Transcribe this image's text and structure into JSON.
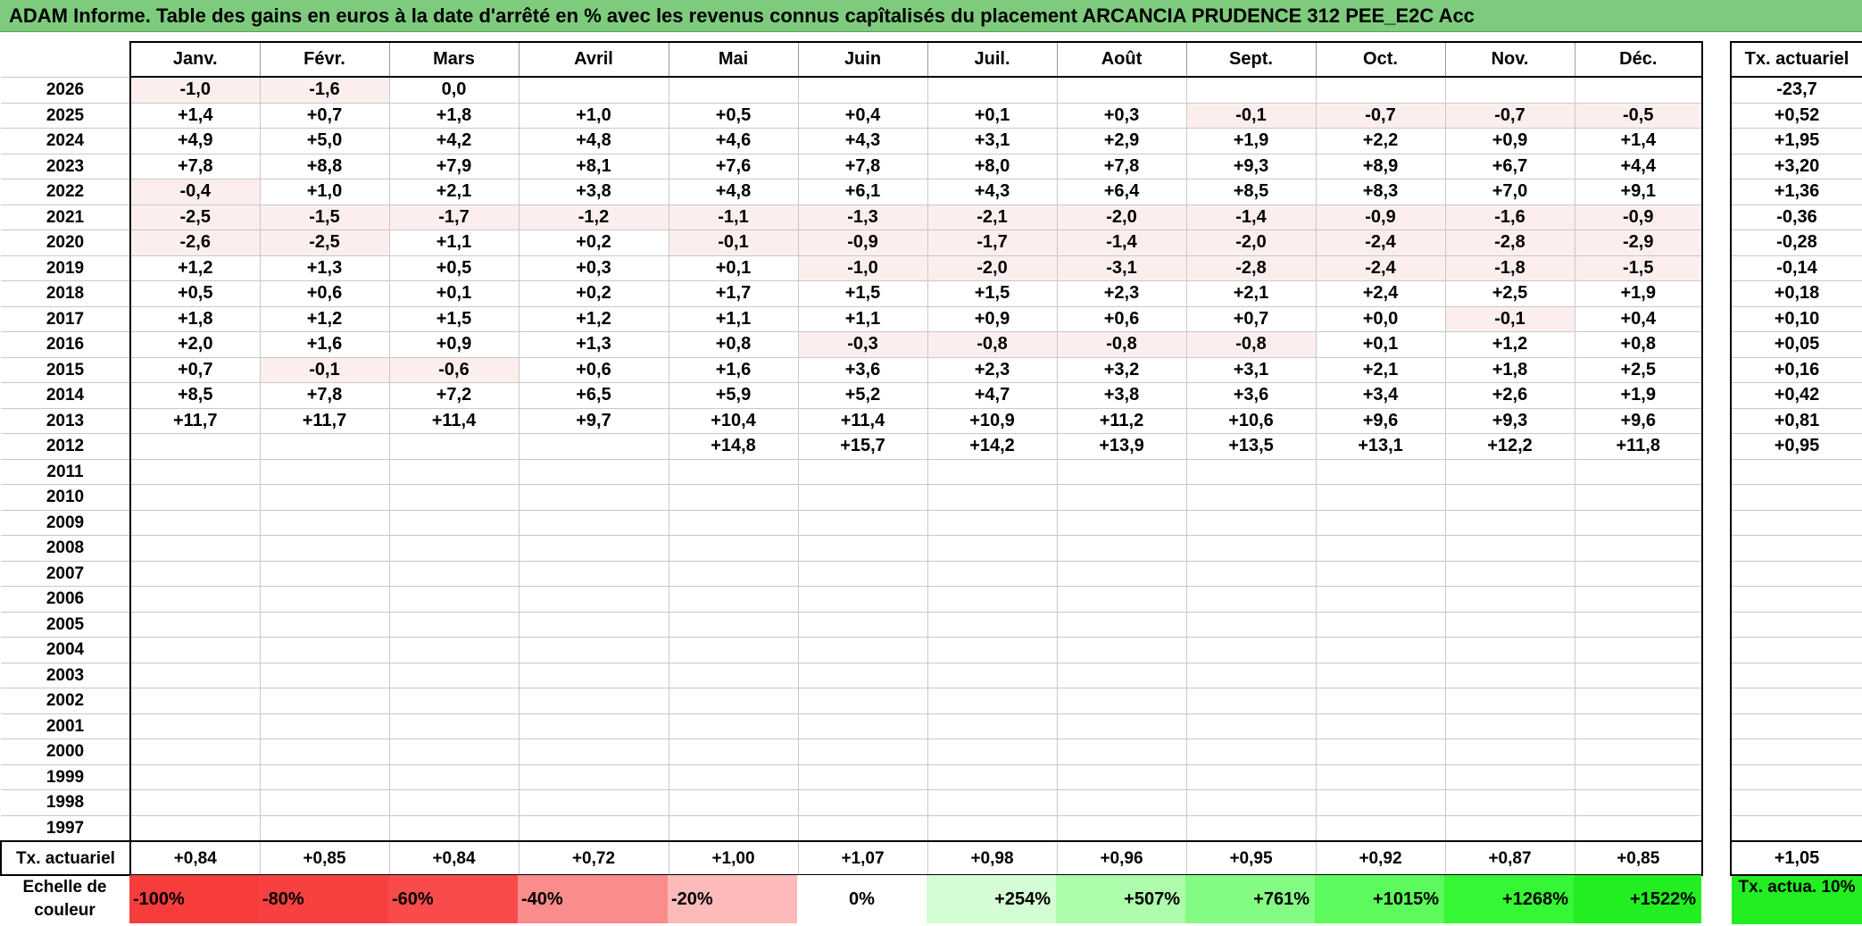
{
  "title": "ADAM Informe. Table des gains en euros à la date d'arrêté en % avec les revenus connus capîtalisés du placement ARCANCIA PRUDENCE 312 PEE_E2C Acc",
  "months": [
    "Janv.",
    "Févr.",
    "Mars",
    "Avril",
    "Mai",
    "Juin",
    "Juil.",
    "Août",
    "Sept.",
    "Oct.",
    "Nov.",
    "Déc."
  ],
  "side_header": "Tx. actuariel",
  "rows": [
    {
      "year": "2026",
      "values": [
        "-1,0",
        "-1,6",
        "0,0",
        "",
        "",
        "",
        "",
        "",
        "",
        "",
        "",
        ""
      ],
      "tx": "-23,7"
    },
    {
      "year": "2025",
      "values": [
        "+1,4",
        "+0,7",
        "+1,8",
        "+1,0",
        "+0,5",
        "+0,4",
        "+0,1",
        "+0,3",
        "-0,1",
        "-0,7",
        "-0,7",
        "-0,5"
      ],
      "tx": "+0,52"
    },
    {
      "year": "2024",
      "values": [
        "+4,9",
        "+5,0",
        "+4,2",
        "+4,8",
        "+4,6",
        "+4,3",
        "+3,1",
        "+2,9",
        "+1,9",
        "+2,2",
        "+0,9",
        "+1,4"
      ],
      "tx": "+1,95"
    },
    {
      "year": "2023",
      "values": [
        "+7,8",
        "+8,8",
        "+7,9",
        "+8,1",
        "+7,6",
        "+7,8",
        "+8,0",
        "+7,8",
        "+9,3",
        "+8,9",
        "+6,7",
        "+4,4"
      ],
      "tx": "+3,20"
    },
    {
      "year": "2022",
      "values": [
        "-0,4",
        "+1,0",
        "+2,1",
        "+3,8",
        "+4,8",
        "+6,1",
        "+4,3",
        "+6,4",
        "+8,5",
        "+8,3",
        "+7,0",
        "+9,1"
      ],
      "tx": "+1,36"
    },
    {
      "year": "2021",
      "values": [
        "-2,5",
        "-1,5",
        "-1,7",
        "-1,2",
        "-1,1",
        "-1,3",
        "-2,1",
        "-2,0",
        "-1,4",
        "-0,9",
        "-1,6",
        "-0,9"
      ],
      "tx": "-0,36"
    },
    {
      "year": "2020",
      "values": [
        "-2,6",
        "-2,5",
        "+1,1",
        "+0,2",
        "-0,1",
        "-0,9",
        "-1,7",
        "-1,4",
        "-2,0",
        "-2,4",
        "-2,8",
        "-2,9"
      ],
      "tx": "-0,28"
    },
    {
      "year": "2019",
      "values": [
        "+1,2",
        "+1,3",
        "+0,5",
        "+0,3",
        "+0,1",
        "-1,0",
        "-2,0",
        "-3,1",
        "-2,8",
        "-2,4",
        "-1,8",
        "-1,5"
      ],
      "tx": "-0,14"
    },
    {
      "year": "2018",
      "values": [
        "+0,5",
        "+0,6",
        "+0,1",
        "+0,2",
        "+1,7",
        "+1,5",
        "+1,5",
        "+2,3",
        "+2,1",
        "+2,4",
        "+2,5",
        "+1,9"
      ],
      "tx": "+0,18"
    },
    {
      "year": "2017",
      "values": [
        "+1,8",
        "+1,2",
        "+1,5",
        "+1,2",
        "+1,1",
        "+1,1",
        "+0,9",
        "+0,6",
        "+0,7",
        "+0,0",
        "-0,1",
        "+0,4"
      ],
      "tx": "+0,10"
    },
    {
      "year": "2016",
      "values": [
        "+2,0",
        "+1,6",
        "+0,9",
        "+1,3",
        "+0,8",
        "-0,3",
        "-0,8",
        "-0,8",
        "-0,8",
        "+0,1",
        "+1,2",
        "+0,8"
      ],
      "tx": "+0,05"
    },
    {
      "year": "2015",
      "values": [
        "+0,7",
        "-0,1",
        "-0,6",
        "+0,6",
        "+1,6",
        "+3,6",
        "+2,3",
        "+3,2",
        "+3,1",
        "+2,1",
        "+1,8",
        "+2,5"
      ],
      "tx": "+0,16"
    },
    {
      "year": "2014",
      "values": [
        "+8,5",
        "+7,8",
        "+7,2",
        "+6,5",
        "+5,9",
        "+5,2",
        "+4,7",
        "+3,8",
        "+3,6",
        "+3,4",
        "+2,6",
        "+1,9"
      ],
      "tx": "+0,42"
    },
    {
      "year": "2013",
      "values": [
        "+11,7",
        "+11,7",
        "+11,4",
        "+9,7",
        "+10,4",
        "+11,4",
        "+10,9",
        "+11,2",
        "+10,6",
        "+9,6",
        "+9,3",
        "+9,6"
      ],
      "tx": "+0,81"
    },
    {
      "year": "2012",
      "values": [
        "",
        "",
        "",
        "",
        "+14,8",
        "+15,7",
        "+14,2",
        "+13,9",
        "+13,5",
        "+13,1",
        "+12,2",
        "+11,8"
      ],
      "tx": "+0,95"
    },
    {
      "year": "2011",
      "values": [
        "",
        "",
        "",
        "",
        "",
        "",
        "",
        "",
        "",
        "",
        "",
        ""
      ],
      "tx": ""
    },
    {
      "year": "2010",
      "values": [
        "",
        "",
        "",
        "",
        "",
        "",
        "",
        "",
        "",
        "",
        "",
        ""
      ],
      "tx": ""
    },
    {
      "year": "2009",
      "values": [
        "",
        "",
        "",
        "",
        "",
        "",
        "",
        "",
        "",
        "",
        "",
        ""
      ],
      "tx": ""
    },
    {
      "year": "2008",
      "values": [
        "",
        "",
        "",
        "",
        "",
        "",
        "",
        "",
        "",
        "",
        "",
        ""
      ],
      "tx": ""
    },
    {
      "year": "2007",
      "values": [
        "",
        "",
        "",
        "",
        "",
        "",
        "",
        "",
        "",
        "",
        "",
        ""
      ],
      "tx": ""
    },
    {
      "year": "2006",
      "values": [
        "",
        "",
        "",
        "",
        "",
        "",
        "",
        "",
        "",
        "",
        "",
        ""
      ],
      "tx": ""
    },
    {
      "year": "2005",
      "values": [
        "",
        "",
        "",
        "",
        "",
        "",
        "",
        "",
        "",
        "",
        "",
        ""
      ],
      "tx": ""
    },
    {
      "year": "2004",
      "values": [
        "",
        "",
        "",
        "",
        "",
        "",
        "",
        "",
        "",
        "",
        "",
        ""
      ],
      "tx": ""
    },
    {
      "year": "2003",
      "values": [
        "",
        "",
        "",
        "",
        "",
        "",
        "",
        "",
        "",
        "",
        "",
        ""
      ],
      "tx": ""
    },
    {
      "year": "2002",
      "values": [
        "",
        "",
        "",
        "",
        "",
        "",
        "",
        "",
        "",
        "",
        "",
        ""
      ],
      "tx": ""
    },
    {
      "year": "2001",
      "values": [
        "",
        "",
        "",
        "",
        "",
        "",
        "",
        "",
        "",
        "",
        "",
        ""
      ],
      "tx": ""
    },
    {
      "year": "2000",
      "values": [
        "",
        "",
        "",
        "",
        "",
        "",
        "",
        "",
        "",
        "",
        "",
        ""
      ],
      "tx": ""
    },
    {
      "year": "1999",
      "values": [
        "",
        "",
        "",
        "",
        "",
        "",
        "",
        "",
        "",
        "",
        "",
        ""
      ],
      "tx": ""
    },
    {
      "year": "1998",
      "values": [
        "",
        "",
        "",
        "",
        "",
        "",
        "",
        "",
        "",
        "",
        "",
        ""
      ],
      "tx": ""
    },
    {
      "year": "1997",
      "values": [
        "",
        "",
        "",
        "",
        "",
        "",
        "",
        "",
        "",
        "",
        "",
        ""
      ],
      "tx": ""
    }
  ],
  "total_row": {
    "label": "Tx. actuariel",
    "values": [
      "+0,84",
      "+0,85",
      "+0,84",
      "+0,72",
      "+1,00",
      "+1,07",
      "+0,98",
      "+0,96",
      "+0,95",
      "+0,92",
      "+0,87",
      "+0,85"
    ],
    "tx": "+1,05"
  },
  "legend": {
    "label": "Echelle de couleur",
    "items": [
      {
        "text": "-100%",
        "color": "#f73c3c"
      },
      {
        "text": "-80%",
        "color": "#f84040"
      },
      {
        "text": "-60%",
        "color": "#f94b4b"
      },
      {
        "text": "-40%",
        "color": "#fb8c8c"
      },
      {
        "text": "-20%",
        "color": "#fdbaba"
      },
      {
        "text": "0%",
        "color": "#ffffff"
      },
      {
        "text": "+254%",
        "color": "#d5fdd5"
      },
      {
        "text": "+507%",
        "color": "#adfdad"
      },
      {
        "text": "+761%",
        "color": "#84fc84"
      },
      {
        "text": "+1015%",
        "color": "#5cfa5c"
      },
      {
        "text": "+1268%",
        "color": "#35f735"
      },
      {
        "text": "+1522%",
        "color": "#22ee22"
      }
    ],
    "side_text": "Tx. actua. 10%"
  }
}
